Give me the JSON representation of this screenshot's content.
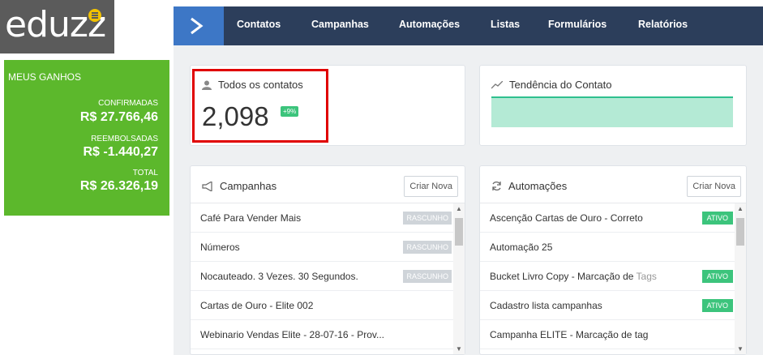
{
  "logo": {
    "text": "eduzz"
  },
  "earnings": {
    "title": "MEUS GANHOS",
    "confirmed_label": "CONFIRMADAS",
    "confirmed_value": "R$ 27.766,46",
    "refunded_label": "REEMBOLSADAS",
    "refunded_value": "R$ -1.440,27",
    "total_label": "TOTAL",
    "total_value": "R$ 26.326,19"
  },
  "nav": {
    "items": [
      "Contatos",
      "Campanhas",
      "Automações",
      "Listas",
      "Formulários",
      "Relatórios"
    ]
  },
  "contacts_card": {
    "title": "Todos os contatos",
    "count": "2,098",
    "change": "+9%"
  },
  "trend_card": {
    "title": "Tendência do Contato"
  },
  "campaigns": {
    "title": "Campanhas",
    "new_button": "Criar Nova",
    "items": [
      {
        "name": "Café Para Vender Mais",
        "status": "RASCUNHO"
      },
      {
        "name": "Números",
        "status": "RASCUNHO"
      },
      {
        "name": "Nocauteado. 3 Vezes. 30 Segundos.",
        "status": "RASCUNHO"
      },
      {
        "name": "Cartas de Ouro - Elite 002",
        "status": ""
      },
      {
        "name": "Webinario Vendas Elite - 28-07-16 - Prov...",
        "status": ""
      }
    ]
  },
  "automations": {
    "title": "Automações",
    "new_button": "Criar Nova",
    "items": [
      {
        "name": "Ascenção Cartas de Ouro - Correto",
        "status": "ATIVO"
      },
      {
        "name": "Automação 25",
        "status": ""
      },
      {
        "name_main": "Bucket Livro Copy - Marcação de",
        "name_muted": "Tags",
        "status": "ATIVO"
      },
      {
        "name": "Cadastro lista campanhas",
        "status": "ATIVO"
      },
      {
        "name": "Campanha ELITE - Marcação de tag",
        "status": ""
      }
    ]
  },
  "colors": {
    "nav_bg": "#2c3e5b",
    "nav_brand": "#3d77c6",
    "earnings_bg": "#5cb82c",
    "active_badge": "#3cc47c",
    "highlight_border": "#e00000"
  },
  "icons": {
    "nav_brand": "chevron-right-icon",
    "contacts": "user-icon",
    "trend": "trend-line-icon",
    "campaigns": "megaphone-icon",
    "automations": "refresh-icon"
  }
}
